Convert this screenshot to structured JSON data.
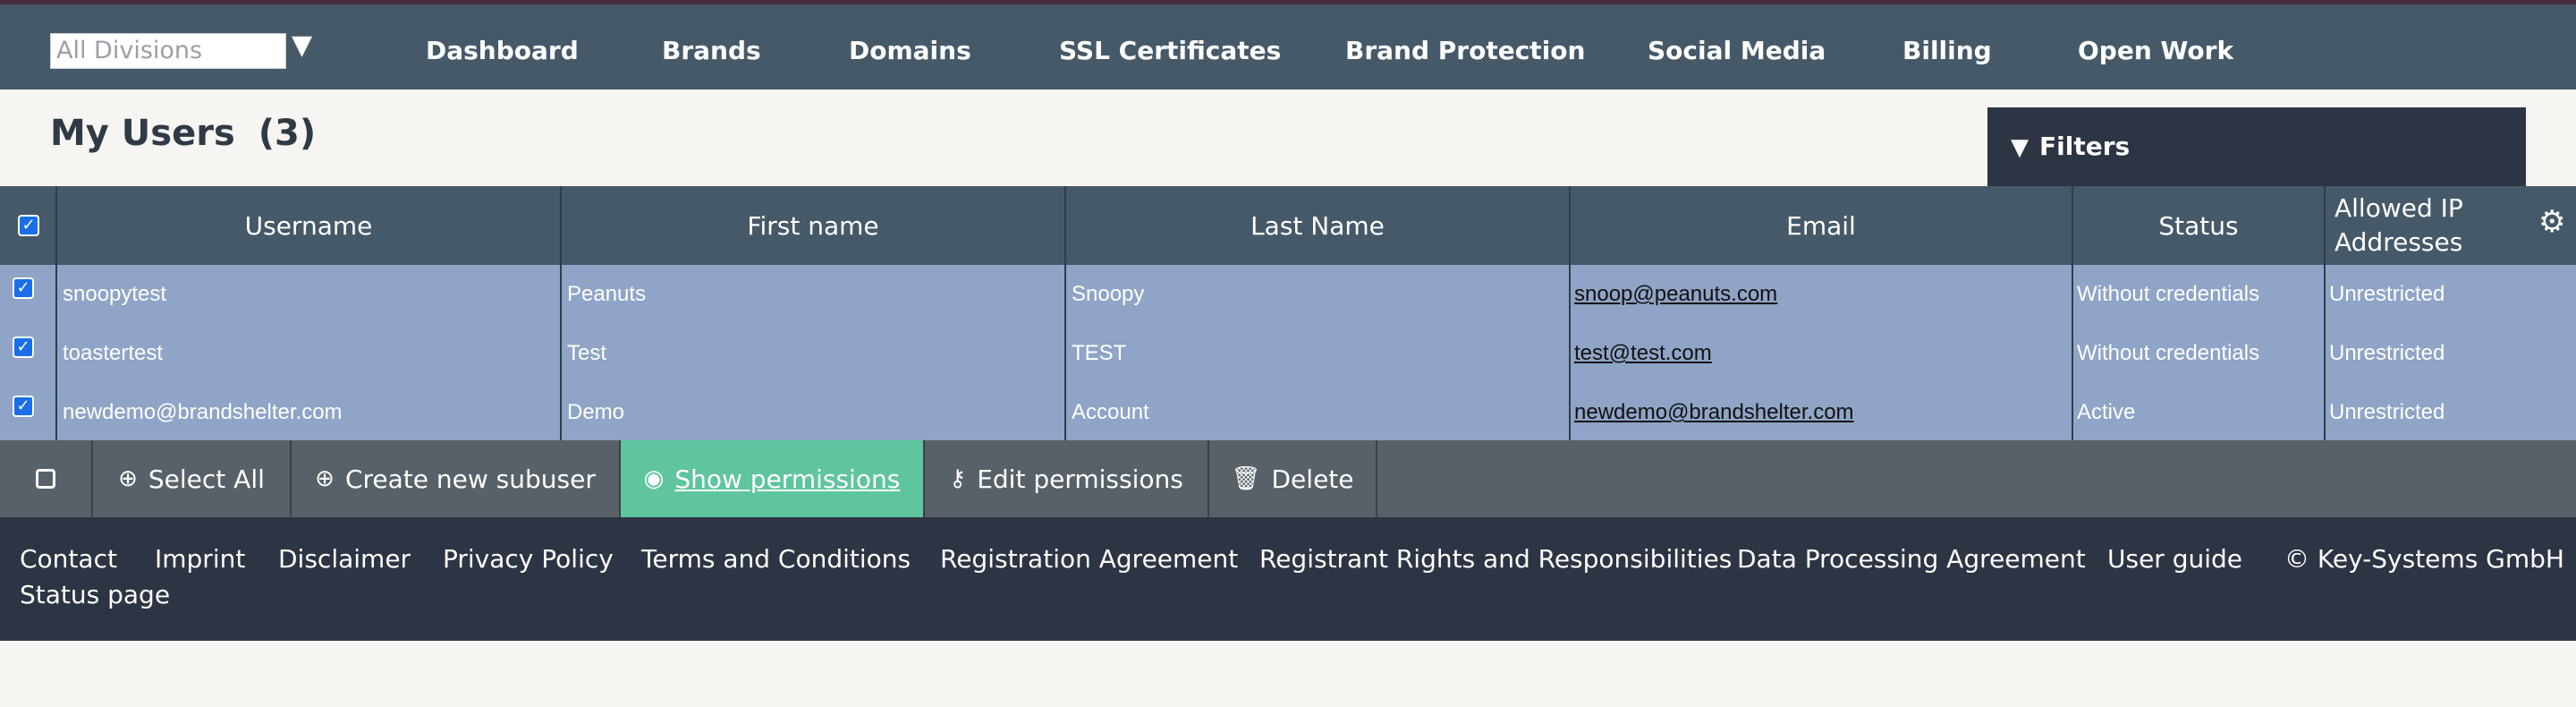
{
  "topnav": {
    "division_select": {
      "placeholder": "All Divisions"
    },
    "items": [
      "Dashboard",
      "Brands",
      "Domains",
      "SSL Certificates",
      "Brand Protection",
      "Social Media",
      "Billing",
      "Open Work"
    ]
  },
  "page": {
    "title": "My Users",
    "count": "(3)",
    "filters_label": "Filters"
  },
  "table": {
    "headers": {
      "username": "Username",
      "first_name": "First name",
      "last_name": "Last Name",
      "email": "Email",
      "status": "Status",
      "allowed_ip": "Allowed IP Addresses"
    },
    "rows": [
      {
        "username": "snoopytest",
        "first_name": "Peanuts",
        "last_name": "Snoopy",
        "email": "snoop@peanuts.com",
        "status": "Without credentials",
        "allowed_ip": "Unrestricted",
        "checked": true
      },
      {
        "username": "toastertest",
        "first_name": "Test",
        "last_name": "TEST",
        "email": "test@test.com",
        "status": "Without credentials",
        "allowed_ip": "Unrestricted",
        "checked": true
      },
      {
        "username": "newdemo@brandshelter.com",
        "first_name": "Demo",
        "last_name": "Account",
        "email": "newdemo@brandshelter.com",
        "status": "Active",
        "allowed_ip": "Unrestricted",
        "checked": true
      }
    ]
  },
  "actions": {
    "select_all": "Select All",
    "create_subuser": "Create new subuser",
    "show_permissions": "Show permissions",
    "edit_permissions": "Edit permissions",
    "delete": "Delete"
  },
  "footer": {
    "links": [
      "Contact",
      "Imprint",
      "Disclaimer",
      "Privacy Policy",
      "Terms and Conditions",
      "Registration Agreement",
      "Registrant Rights and Responsibilities",
      "Data Processing Agreement",
      "User guide"
    ],
    "copyright": "© Key-Systems GmbH",
    "status_page": "Status page"
  },
  "colors": {
    "nav_bg": "#465968",
    "rows_bg": "#8fa4c6",
    "active_action": "#5fc59e",
    "footer_bg": "#2d3444"
  },
  "icons": {
    "division_caret": "triangle-down-icon",
    "filters": "triangle-down-icon",
    "settings": "gear-icon",
    "select_all": "plus-circle-icon",
    "create_subuser": "plus-circle-icon",
    "show_permissions": "eye-icon",
    "edit_permissions": "key-icon",
    "delete": "trash-icon"
  }
}
